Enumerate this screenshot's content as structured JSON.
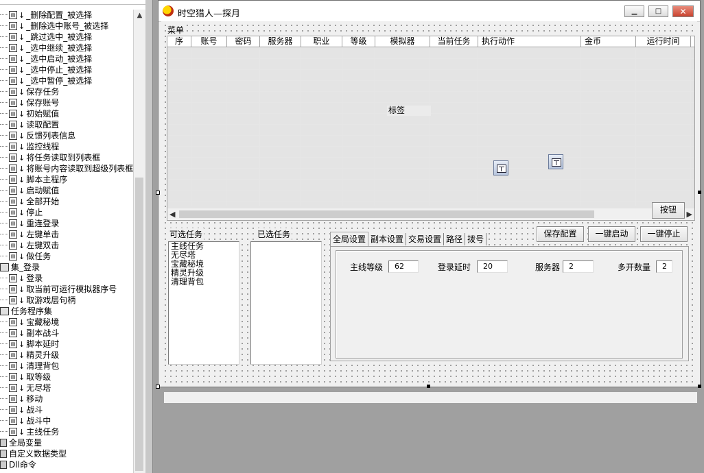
{
  "tree": {
    "items": [
      {
        "label": "_删除配置_被选择",
        "kind": "sub"
      },
      {
        "label": "_删除选中账号_被选择",
        "kind": "sub"
      },
      {
        "label": "_跳过选中_被选择",
        "kind": "sub"
      },
      {
        "label": "_选中继续_被选择",
        "kind": "sub"
      },
      {
        "label": "_选中启动_被选择",
        "kind": "sub"
      },
      {
        "label": "_选中停止_被选择",
        "kind": "sub"
      },
      {
        "label": "_选中暂停_被选择",
        "kind": "sub"
      },
      {
        "label": "保存任务",
        "kind": "sub"
      },
      {
        "label": "保存账号",
        "kind": "sub"
      },
      {
        "label": "初始赋值",
        "kind": "sub"
      },
      {
        "label": "读取配置",
        "kind": "sub"
      },
      {
        "label": "反馈列表信息",
        "kind": "sub"
      },
      {
        "label": "监控线程",
        "kind": "sub"
      },
      {
        "label": "将任务读取到列表框",
        "kind": "sub"
      },
      {
        "label": "将账号内容读取到超级列表框",
        "kind": "sub"
      },
      {
        "label": "脚本主程序",
        "kind": "sub"
      },
      {
        "label": "启动赋值",
        "kind": "sub"
      },
      {
        "label": "全部开始",
        "kind": "sub"
      },
      {
        "label": "停止",
        "kind": "sub"
      },
      {
        "label": "重连登录",
        "kind": "sub"
      },
      {
        "label": "左键单击",
        "kind": "sub"
      },
      {
        "label": "左键双击",
        "kind": "sub"
      },
      {
        "label": "做任务",
        "kind": "sub"
      },
      {
        "label": "集_登录",
        "kind": "group"
      },
      {
        "label": "登录",
        "kind": "sub"
      },
      {
        "label": "取当前可运行模拟器序号",
        "kind": "sub"
      },
      {
        "label": "取游戏层句柄",
        "kind": "sub"
      },
      {
        "label": "任务程序集",
        "kind": "group"
      },
      {
        "label": "宝藏秘境",
        "kind": "sub"
      },
      {
        "label": "副本战斗",
        "kind": "sub"
      },
      {
        "label": "脚本延时",
        "kind": "sub"
      },
      {
        "label": "精灵升级",
        "kind": "sub"
      },
      {
        "label": "清理背包",
        "kind": "sub"
      },
      {
        "label": "取等级",
        "kind": "sub"
      },
      {
        "label": "无尽塔",
        "kind": "sub"
      },
      {
        "label": "移动",
        "kind": "sub"
      },
      {
        "label": "战斗",
        "kind": "sub"
      },
      {
        "label": "战斗中",
        "kind": "sub"
      },
      {
        "label": "主线任务",
        "kind": "sub"
      },
      {
        "label": "全局变量",
        "kind": "root"
      },
      {
        "label": "自定义数据类型",
        "kind": "root"
      },
      {
        "label": "Dll命令",
        "kind": "root"
      }
    ]
  },
  "window": {
    "title": "时空猎人—探月",
    "menu_label": "菜单",
    "minimize_icon": "minimize-icon",
    "maximize_icon": "maximize-icon",
    "close_icon": "close-icon"
  },
  "grid": {
    "columns": [
      "序",
      "账号",
      "密码",
      "服务器",
      "职业",
      "等级",
      "模拟器",
      "当前任务",
      "执行动作",
      "金币",
      "运行时间"
    ]
  },
  "label_text": "标签",
  "button_text": "按钮",
  "task_panel": {
    "available_label": "可选任务",
    "selected_label": "已选任务",
    "available_items": [
      "主线任务",
      "无尽塔",
      "宝藏秘境",
      "精灵升级",
      "清理背包"
    ],
    "selected_items": []
  },
  "tabs": [
    "全局设置",
    "副本设置",
    "交易设置",
    "路径",
    "拨号"
  ],
  "actions": {
    "save_config": "保存配置",
    "start_all": "一键启动",
    "stop_all": "一键停止"
  },
  "settings": {
    "main_level_label": "主线等级",
    "main_level_value": "62",
    "login_delay_label": "登录延时",
    "login_delay_value": "20",
    "server_label": "服务器",
    "server_value": "2",
    "multi_count_label": "多开数量",
    "multi_count_value": "2"
  }
}
